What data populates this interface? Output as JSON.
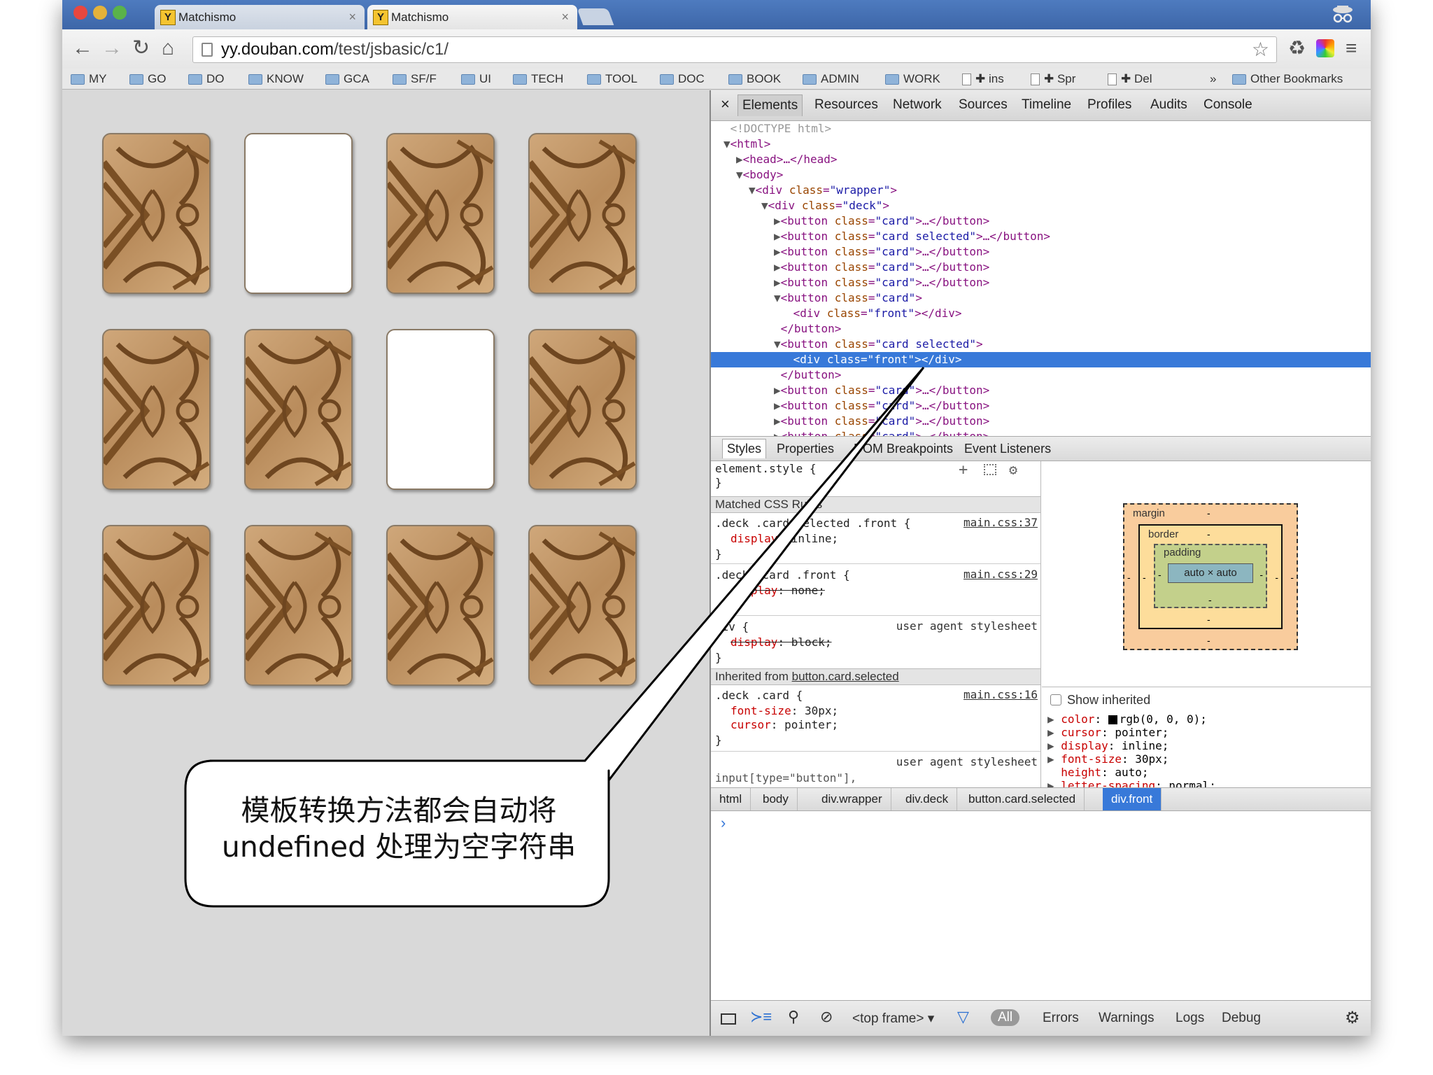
{
  "browser": {
    "tabs": [
      {
        "title": "Matchismo",
        "favicon": "Y",
        "close": "×"
      },
      {
        "title": "Matchismo",
        "favicon": "Y",
        "close": "×"
      }
    ],
    "url_host": "yy.douban.com",
    "url_path": "/test/jsbasic/c1/",
    "bookmarks": [
      "MY",
      "GO",
      "DO",
      "KNOW",
      "GCA",
      "SF/F",
      "UI",
      "TECH",
      "TOOL",
      "DOC",
      "BOOK",
      "ADMIN",
      "WORK",
      "✚ ins",
      "✚ Spr",
      "✚ Del",
      "»",
      "Other Bookmarks"
    ],
    "icons": {
      "back": "back-icon",
      "forward": "forward-icon",
      "reload": "reload-icon",
      "home": "home-icon",
      "star": "star-icon",
      "menu": "menu-icon"
    }
  },
  "page": {
    "cards": [
      {
        "state": "back"
      },
      {
        "state": "face"
      },
      {
        "state": "back"
      },
      {
        "state": "back"
      },
      {
        "state": "back"
      },
      {
        "state": "back"
      },
      {
        "state": "face"
      },
      {
        "state": "back"
      },
      {
        "state": "back"
      },
      {
        "state": "back"
      },
      {
        "state": "back"
      },
      {
        "state": "back"
      }
    ]
  },
  "devtools": {
    "close": "×",
    "tabs": [
      "Elements",
      "Resources",
      "Network",
      "Sources",
      "Timeline",
      "Profiles",
      "Audits",
      "Console"
    ],
    "dom": [
      {
        "indent": 1,
        "tri": "",
        "text": "<!DOCTYPE html>",
        "kind": "doctype"
      },
      {
        "indent": 1,
        "tri": "▼",
        "tag": "html"
      },
      {
        "indent": 2,
        "tri": "▶",
        "tag": "head",
        "rest": "…</head>"
      },
      {
        "indent": 2,
        "tri": "▼",
        "tag": "body"
      },
      {
        "indent": 3,
        "tri": "▼",
        "tag": "div",
        "attr": "class",
        "val": "wrapper"
      },
      {
        "indent": 4,
        "tri": "▼",
        "tag": "div",
        "attr": "class",
        "val": "deck"
      },
      {
        "indent": 5,
        "tri": "▶",
        "tag": "button",
        "attr": "class",
        "val": "card",
        "rest": "…</button>"
      },
      {
        "indent": 5,
        "tri": "▶",
        "tag": "button",
        "attr": "class",
        "val": "card selected",
        "rest": "…</button>"
      },
      {
        "indent": 5,
        "tri": "▶",
        "tag": "button",
        "attr": "class",
        "val": "card",
        "rest": "…</button>"
      },
      {
        "indent": 5,
        "tri": "▶",
        "tag": "button",
        "attr": "class",
        "val": "card",
        "rest": "…</button>"
      },
      {
        "indent": 5,
        "tri": "▶",
        "tag": "button",
        "attr": "class",
        "val": "card",
        "rest": "…</button>"
      },
      {
        "indent": 5,
        "tri": "▼",
        "tag": "button",
        "attr": "class",
        "val": "card"
      },
      {
        "indent": 6,
        "tri": "",
        "tag": "div",
        "attr": "class",
        "val": "front",
        "rest": "</div>"
      },
      {
        "indent": 5,
        "tri": "",
        "text": "</button>",
        "kind": "close"
      },
      {
        "indent": 5,
        "tri": "▼",
        "tag": "button",
        "attr": "class",
        "val": "card selected"
      },
      {
        "indent": 6,
        "tri": "",
        "tag": "div",
        "attr": "class",
        "val": "front",
        "rest": "</div>",
        "selected": true
      },
      {
        "indent": 5,
        "tri": "",
        "text": "</button>",
        "kind": "close"
      },
      {
        "indent": 5,
        "tri": "▶",
        "tag": "button",
        "attr": "class",
        "val": "card",
        "rest": "…</button>"
      },
      {
        "indent": 5,
        "tri": "▶",
        "tag": "button",
        "attr": "class",
        "val": "card",
        "rest": "…</button>"
      },
      {
        "indent": 5,
        "tri": "▶",
        "tag": "button",
        "attr": "class",
        "val": "card",
        "rest": "…</button>"
      },
      {
        "indent": 5,
        "tri": "▶",
        "tag": "button",
        "attr": "class",
        "val": "card",
        "rest": "…</button>"
      }
    ],
    "subtabs": [
      "Styles",
      "Properties",
      "DOM Breakpoints",
      "Event Listeners"
    ],
    "styles": {
      "element_style": "element.style {",
      "close_brace": "}",
      "matched_header": "Matched CSS Rules",
      "rule1_selector": ".deck .card.selected .front {",
      "rule1_source": "main.css:37",
      "rule1_prop": "display",
      "rule1_val": ": inline;",
      "rule2_selector": ".deck .card .front {",
      "rule2_source": "main.css:29",
      "rule2_prop": "display",
      "rule2_val": ": none;",
      "rule3_selector": "div {",
      "rule3_source": "user agent stylesheet",
      "rule3_prop": "display",
      "rule3_val": ": block;",
      "inherited_label": "Inherited from ",
      "inherited_link": "button.card.selected",
      "rule4_selector": ".deck .card {",
      "rule4_source": "main.css:16",
      "rule4_prop1": "font-size",
      "rule4_val1": ": 30px;",
      "rule4_prop2": "cursor",
      "rule4_val2": ": pointer;",
      "rule5_source": "user agent stylesheet",
      "rule5_selector": "input[type=\"button\"],"
    },
    "boxmodel": {
      "margin": "margin",
      "border": "border",
      "padding": "padding",
      "content": "auto × auto",
      "dash": "-"
    },
    "computed": {
      "show_inherited": "Show inherited",
      "rows": [
        {
          "prop": "color",
          "val": "rgb(0, 0, 0);",
          "swatch": "#000000"
        },
        {
          "prop": "cursor",
          "val": "pointer;"
        },
        {
          "prop": "display",
          "val": "inline;"
        },
        {
          "prop": "font-size",
          "val": "30px;"
        },
        {
          "prop": "height",
          "val": "auto;",
          "plain": true
        },
        {
          "prop": "letter-spacing",
          "val": "normal;"
        }
      ]
    },
    "breadcrumbs": [
      "html",
      "body",
      "div.wrapper",
      "div.deck",
      "button.card.selected",
      "div.front"
    ],
    "console_prompt": "›",
    "status": {
      "frame": "<top frame>",
      "all": "All",
      "errors": "Errors",
      "warnings": "Warnings",
      "logs": "Logs",
      "debug": "Debug"
    }
  },
  "callout": {
    "line1": "模板转换方法都会自动将",
    "line2": "undefined 处理为空字符串"
  }
}
